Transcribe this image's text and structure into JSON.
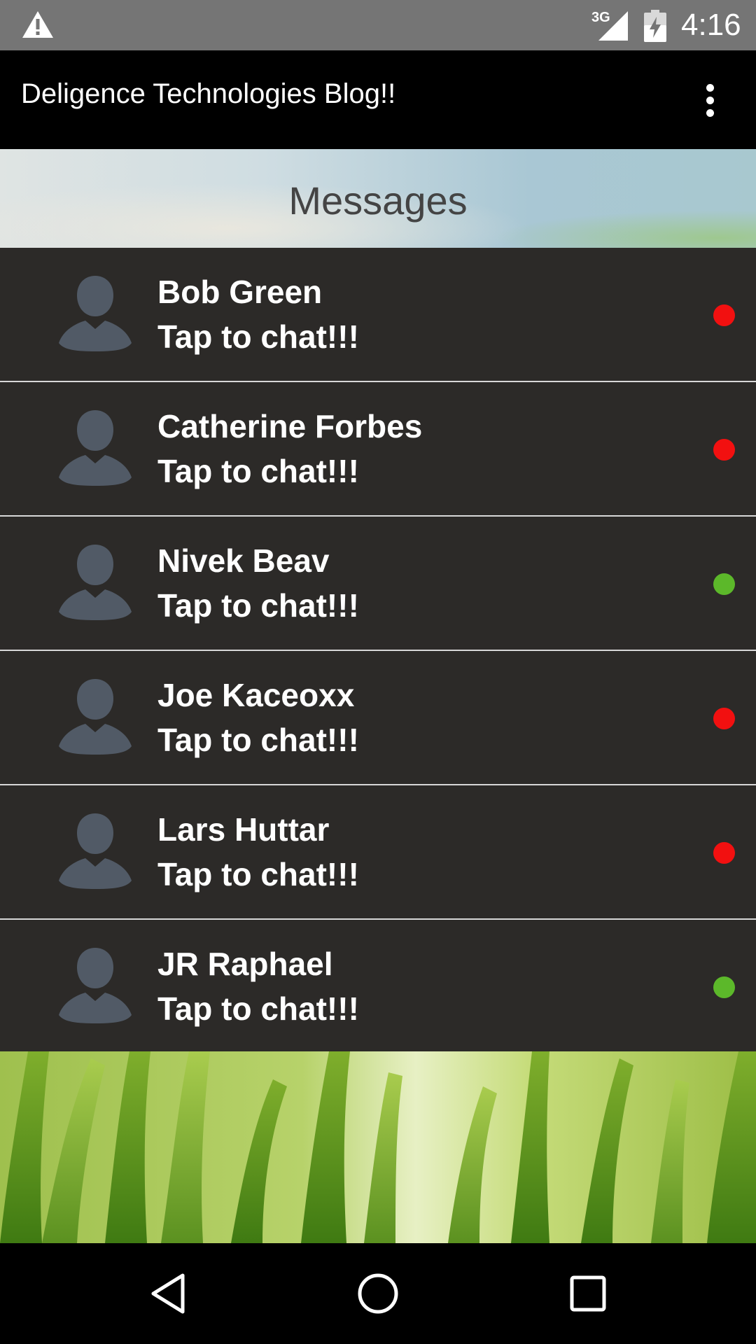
{
  "status_bar": {
    "network_type": "3G",
    "time": "4:16"
  },
  "app_bar": {
    "title": "Deligence Technologies Blog!!"
  },
  "messages_header": {
    "title": "Messages"
  },
  "contacts": [
    {
      "name": "Bob Green",
      "subtitle": "Tap to chat!!!",
      "status": "offline"
    },
    {
      "name": "Catherine Forbes",
      "subtitle": "Tap to chat!!!",
      "status": "offline"
    },
    {
      "name": "Nivek Beav",
      "subtitle": "Tap to chat!!!",
      "status": "online"
    },
    {
      "name": "Joe Kaceoxx",
      "subtitle": "Tap to chat!!!",
      "status": "offline"
    },
    {
      "name": "Lars Huttar",
      "subtitle": "Tap to chat!!!",
      "status": "offline"
    },
    {
      "name": "JR Raphael",
      "subtitle": "Tap to chat!!!",
      "status": "online"
    }
  ],
  "colors": {
    "online": "#5cb82a",
    "offline": "#f21010",
    "row_background": "#2c2a28",
    "avatar": "#515a66"
  },
  "icons": {
    "status_warning": "warning-icon",
    "signal": "signal-icon",
    "battery": "battery-icon",
    "overflow": "overflow-menu-icon",
    "nav_back": "back-icon",
    "nav_home": "home-icon",
    "nav_recents": "recents-icon",
    "avatar": "user-avatar-icon"
  }
}
